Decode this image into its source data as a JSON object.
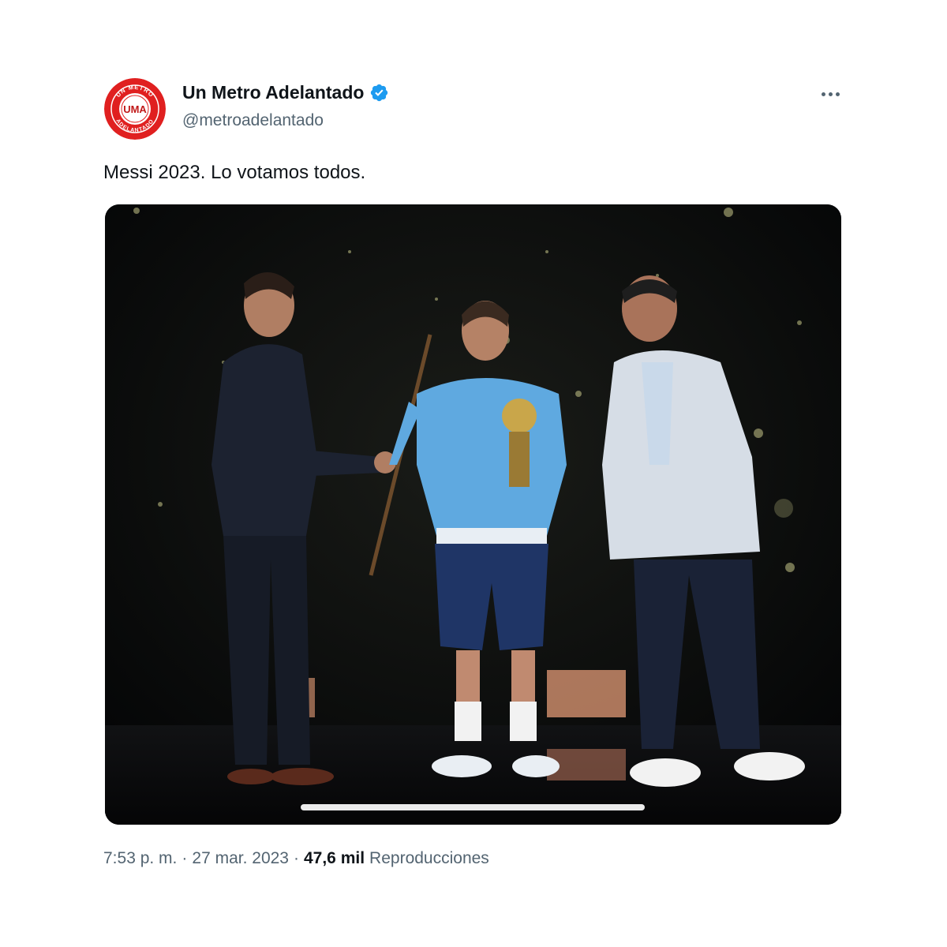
{
  "account": {
    "display_name": "Un Metro Adelantado",
    "handle": "@metroadelantado",
    "verified": true,
    "avatar_icon": "una-logo-icon",
    "avatar_logo_text_top": "UN METRO",
    "avatar_logo_text_center": "UMA",
    "avatar_logo_text_bottom": "ADELANTADO",
    "accent_color": "#e02020"
  },
  "tweet": {
    "text": "Messi 2023. Lo votamos todos.",
    "media_type": "video",
    "video_progress": 1.0
  },
  "meta": {
    "time": "7:53 p. m.",
    "separator": "·",
    "date": "27 mar. 2023",
    "views_count": "47,6 mil",
    "views_label": "Reproducciones"
  },
  "icons": {
    "verified": "verified-badge-icon",
    "more": "more-horizontal-icon"
  },
  "colors": {
    "verified_blue": "#1d9bf0",
    "secondary_text": "#536471",
    "primary_text": "#0f1419"
  }
}
